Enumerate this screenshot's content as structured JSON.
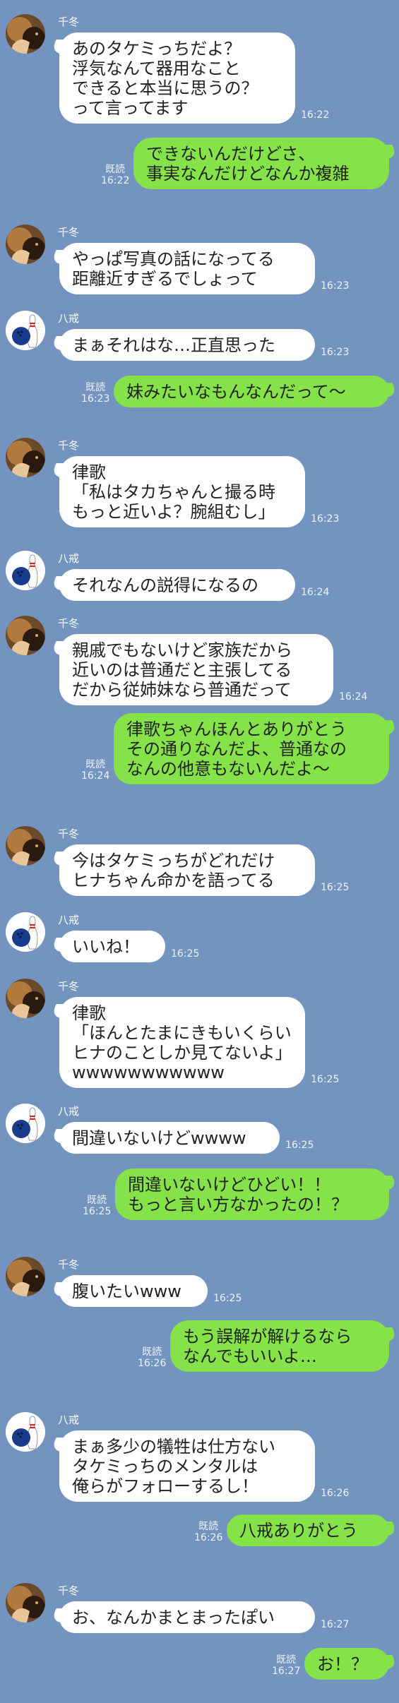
{
  "senders": {
    "chifuyu": "千冬",
    "hakkai": "八戒"
  },
  "read_label": "既読",
  "colors": {
    "background": "#7494c0",
    "incoming_bubble": "#ffffff",
    "outgoing_bubble": "#85e249"
  },
  "messages": [
    {
      "dir": "in",
      "sender": "千冬",
      "avatar": "cat-avatar-icon",
      "text": "あのタケミっちだよ？\n浮気なんて器用なこと\nできると本当に思うの？\nって言ってます",
      "time": "16:22"
    },
    {
      "dir": "out",
      "read": "既読",
      "text": "できないんだけどさ、\n事実なんだけどなんか複雑",
      "time": "16:22"
    },
    {
      "dir": "in",
      "sender": "千冬",
      "avatar": "cat-avatar-icon",
      "text": "やっぱ写真の話になってる\n距離近すぎるでしょって",
      "time": "16:23"
    },
    {
      "dir": "in",
      "sender": "八戒",
      "avatar": "bowling-avatar-icon",
      "text": "まぁそれはな…正直思った",
      "time": "16:23"
    },
    {
      "dir": "out",
      "read": "既読",
      "text": "妹みたいなもんなんだって〜",
      "time": "16:23"
    },
    {
      "dir": "in",
      "sender": "千冬",
      "avatar": "cat-avatar-icon",
      "text": "律歌\n「私はタカちゃんと撮る時\nもっと近いよ？腕組むし」",
      "time": "16:23"
    },
    {
      "dir": "in",
      "sender": "八戒",
      "avatar": "bowling-avatar-icon",
      "text": "それなんの説得になるの",
      "time": "16:24"
    },
    {
      "dir": "in",
      "sender": "千冬",
      "avatar": "cat-avatar-icon",
      "text": "親戚でもないけど家族だから\n近いのは普通だと主張してる\nだから従姉妹なら普通だって",
      "time": "16:24"
    },
    {
      "dir": "out",
      "read": "既読",
      "text": "律歌ちゃんほんとありがとう\nその通りなんだよ、普通なの\nなんの他意もないんだよ〜",
      "time": "16:24"
    },
    {
      "dir": "in",
      "sender": "千冬",
      "avatar": "cat-avatar-icon",
      "text": "今はタケミっちがどれだけ\nヒナちゃん命かを語ってる",
      "time": "16:25"
    },
    {
      "dir": "in",
      "sender": "八戒",
      "avatar": "bowling-avatar-icon",
      "text": "いいね！",
      "time": "16:25"
    },
    {
      "dir": "in",
      "sender": "千冬",
      "avatar": "cat-avatar-icon",
      "text": "律歌\n「ほんとたまにきもいくらい\nヒナのことしか見てないよ」\nwwwwwwwwwww",
      "time": "16:25"
    },
    {
      "dir": "in",
      "sender": "八戒",
      "avatar": "bowling-avatar-icon",
      "text": "間違いないけどwwww",
      "time": "16:25"
    },
    {
      "dir": "out",
      "read": "既読",
      "text": "間違いないけどひどい！！\nもっと言い方なかったの！？",
      "time": "16:25"
    },
    {
      "dir": "in",
      "sender": "千冬",
      "avatar": "cat-avatar-icon",
      "text": "腹いたいwww",
      "time": "16:25"
    },
    {
      "dir": "out",
      "read": "既読",
      "text": "もう誤解が解けるなら\nなんでもいいよ…",
      "time": "16:26"
    },
    {
      "dir": "in",
      "sender": "八戒",
      "avatar": "bowling-avatar-icon",
      "text": "まぁ多少の犠牲は仕方ない\nタケミっちのメンタルは\n俺らがフォローするし！",
      "time": "16:26"
    },
    {
      "dir": "out",
      "read": "既読",
      "text": "八戒ありがとう",
      "time": "16:26"
    },
    {
      "dir": "in",
      "sender": "千冬",
      "avatar": "cat-avatar-icon",
      "text": "お、なんかまとまったぽい",
      "time": "16:27"
    },
    {
      "dir": "out",
      "read": "既読",
      "text": "お！？",
      "time": "16:27"
    }
  ]
}
